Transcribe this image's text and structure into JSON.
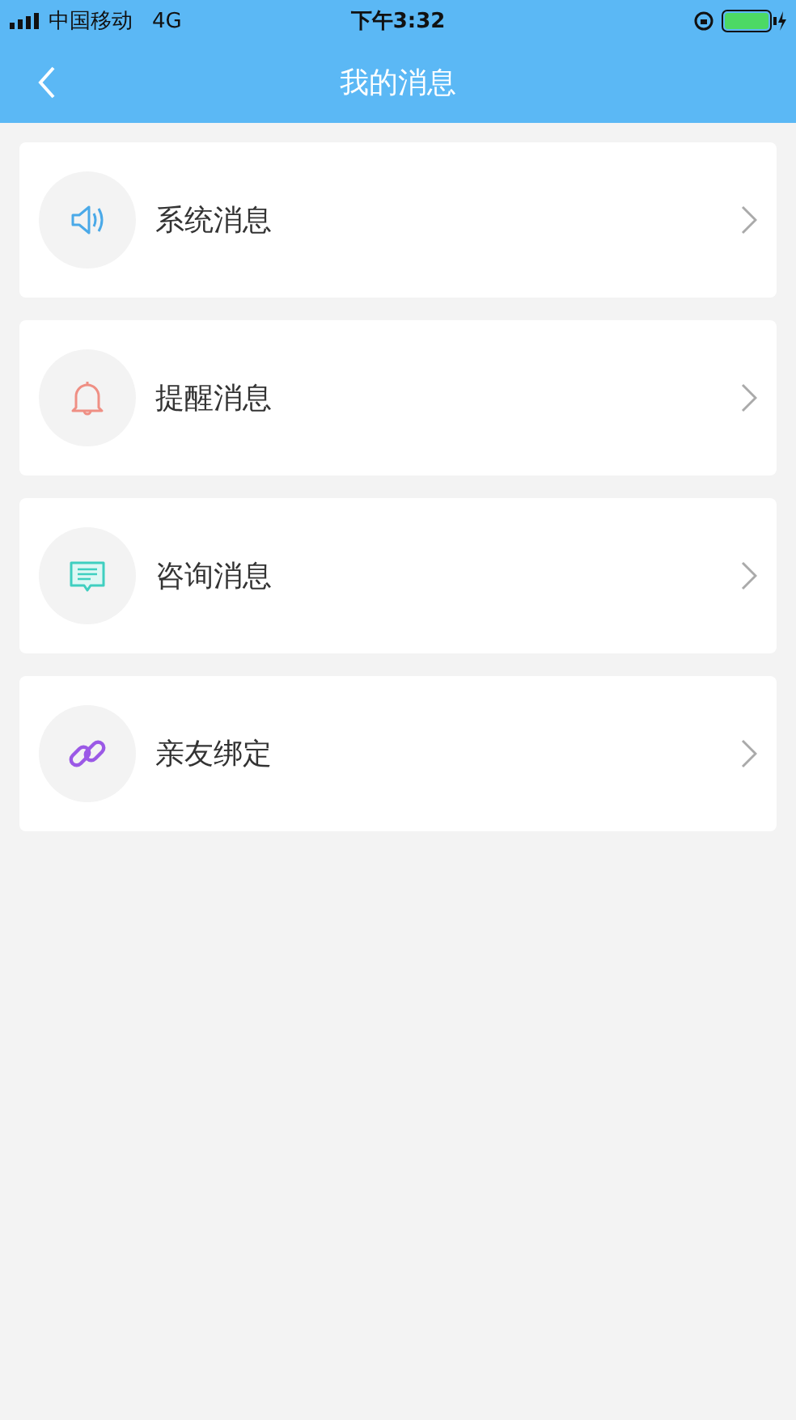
{
  "status_bar": {
    "carrier": "中国移动",
    "network": "4G",
    "time": "下午3:32"
  },
  "nav_bar": {
    "title": "我的消息"
  },
  "items": [
    {
      "kind": "speaker",
      "label": "系统消息"
    },
    {
      "kind": "bell",
      "label": "提醒消息"
    },
    {
      "kind": "chat",
      "label": "咨询消息"
    },
    {
      "kind": "link",
      "label": "亲友绑定"
    }
  ]
}
